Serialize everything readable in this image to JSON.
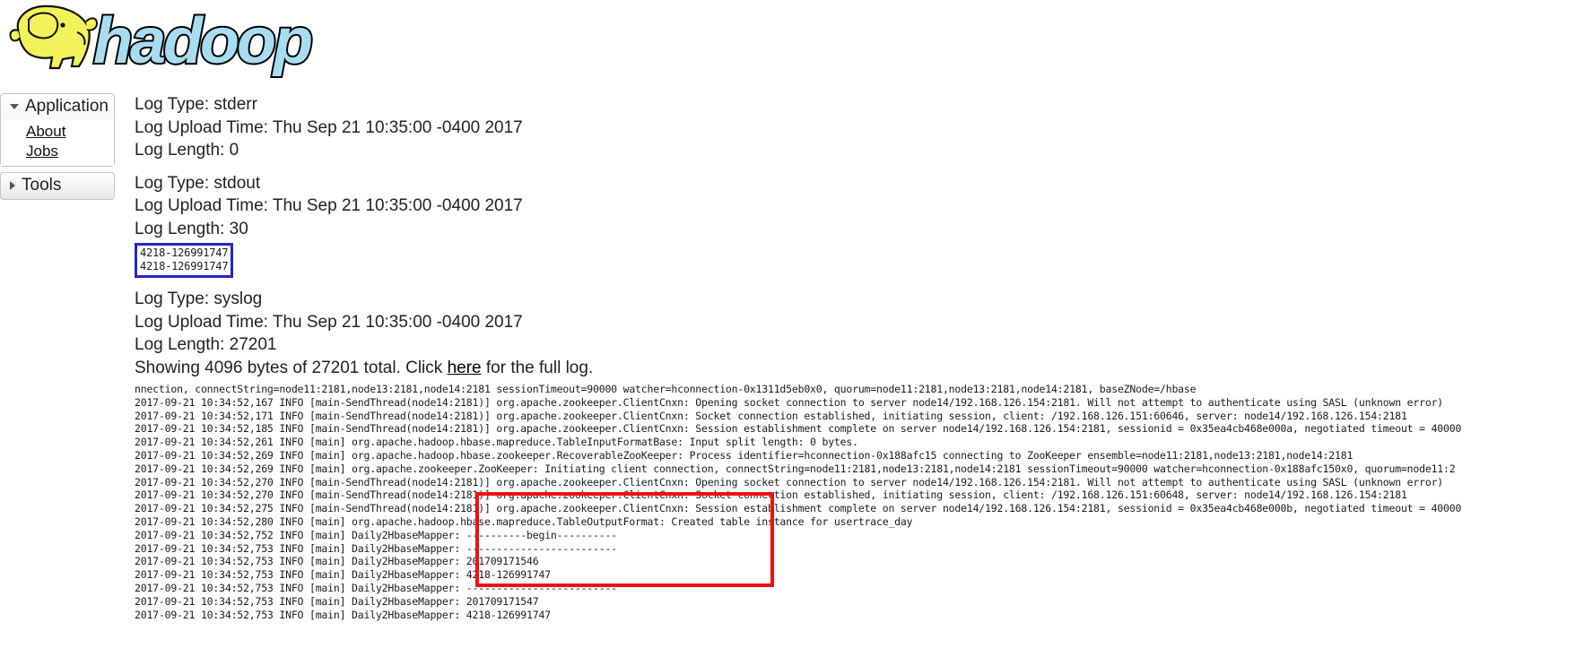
{
  "header": {
    "logo_alt": "hadoop",
    "logo_word": "hadoop",
    "logo_colors": {
      "elephant": "#f2f25a",
      "wordmark": "#a8dcf0",
      "outline": "#000000"
    }
  },
  "sidebar": {
    "sections": [
      {
        "label": "Application",
        "expanded": true,
        "caret": "caret-down-icon",
        "items": [
          {
            "label": "About"
          },
          {
            "label": "Jobs"
          }
        ]
      },
      {
        "label": "Tools",
        "expanded": false,
        "caret": "caret-right-icon",
        "items": []
      }
    ]
  },
  "main": {
    "logs": [
      {
        "type_line": "Log Type: stderr",
        "upload_line": "Log Upload Time: Thu Sep 21 10:35:00 -0400 2017",
        "length_line": "Log Length: 0",
        "body": []
      },
      {
        "type_line": "Log Type: stdout",
        "upload_line": "Log Upload Time: Thu Sep 21 10:35:00 -0400 2017",
        "length_line": "Log Length: 30",
        "body": [
          "4218-126991747",
          "4218-126991747"
        ],
        "highlight": {
          "color": "#2626c8",
          "name": "blue-highlight-box"
        }
      },
      {
        "type_line": "Log Type: syslog",
        "upload_time_line": "Log Upload Time: Thu Sep 21 10:35:00 -0400 2017",
        "length_line": "Log Length: 27201",
        "showing_prefix": "Showing 4096 bytes of 27201 total. Click ",
        "showing_link": "here",
        "showing_suffix": " for the full log.",
        "body": "nnection, connectString=node11:2181,node13:2181,node14:2181 sessionTimeout=90000 watcher=hconnection-0x1311d5eb0x0, quorum=node11:2181,node13:2181,node14:2181, baseZNode=/hbase\n2017-09-21 10:34:52,167 INFO [main-SendThread(node14:2181)] org.apache.zookeeper.ClientCnxn: Opening socket connection to server node14/192.168.126.154:2181. Will not attempt to authenticate using SASL (unknown error)\n2017-09-21 10:34:52,171 INFO [main-SendThread(node14:2181)] org.apache.zookeeper.ClientCnxn: Socket connection established, initiating session, client: /192.168.126.151:60646, server: node14/192.168.126.154:2181\n2017-09-21 10:34:52,185 INFO [main-SendThread(node14:2181)] org.apache.zookeeper.ClientCnxn: Session establishment complete on server node14/192.168.126.154:2181, sessionid = 0x35ea4cb468e000a, negotiated timeout = 40000\n2017-09-21 10:34:52,261 INFO [main] org.apache.hadoop.hbase.mapreduce.TableInputFormatBase: Input split length: 0 bytes.\n2017-09-21 10:34:52,269 INFO [main] org.apache.hadoop.hbase.zookeeper.RecoverableZooKeeper: Process identifier=hconnection-0x188afc15 connecting to ZooKeeper ensemble=node11:2181,node13:2181,node14:2181\n2017-09-21 10:34:52,269 INFO [main] org.apache.zookeeper.ZooKeeper: Initiating client connection, connectString=node11:2181,node13:2181,node14:2181 sessionTimeout=90000 watcher=hconnection-0x188afc150x0, quorum=node11:2\n2017-09-21 10:34:52,270 INFO [main-SendThread(node14:2181)] org.apache.zookeeper.ClientCnxn: Opening socket connection to server node14/192.168.126.154:2181. Will not attempt to authenticate using SASL (unknown error)\n2017-09-21 10:34:52,270 INFO [main-SendThread(node14:2181)] org.apache.zookeeper.ClientCnxn: Socket connection established, initiating session, client: /192.168.126.151:60648, server: node14/192.168.126.154:2181\n2017-09-21 10:34:52,275 INFO [main-SendThread(node14:2181)] org.apache.zookeeper.ClientCnxn: Session establishment complete on server node14/192.168.126.154:2181, sessionid = 0x35ea4cb468e000b, negotiated timeout = 40000\n2017-09-21 10:34:52,280 INFO [main] org.apache.hadoop.hbase.mapreduce.TableOutputFormat: Created table instance for usertrace_day\n2017-09-21 10:34:52,752 INFO [main] Daily2HbaseMapper: ----------begin----------\n2017-09-21 10:34:52,753 INFO [main] Daily2HbaseMapper: -------------------------\n2017-09-21 10:34:52,753 INFO [main] Daily2HbaseMapper: 201709171546\n2017-09-21 10:34:52,753 INFO [main] Daily2HbaseMapper: 4218-126991747\n2017-09-21 10:34:52,753 INFO [main] Daily2HbaseMapper: -------------------------\n2017-09-21 10:34:52,753 INFO [main] Daily2HbaseMapper: 201709171547\n2017-09-21 10:34:52,753 INFO [main] Daily2HbaseMapper: 4218-126991747",
        "highlight": {
          "color": "#ee1111",
          "name": "red-highlight-box"
        }
      }
    ]
  }
}
